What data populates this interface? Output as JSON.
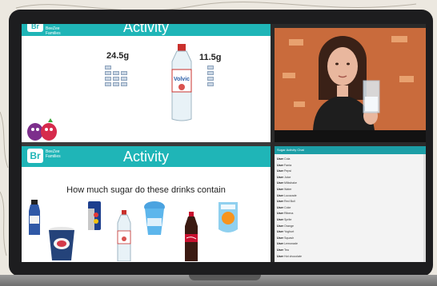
{
  "top_slide": {
    "logo_letter": "Br",
    "logo_text": "BeeZee Families",
    "title": "Activity",
    "left_amount": "24.5g",
    "right_amount": "11.5g"
  },
  "bottom_slide": {
    "logo_letter": "Br",
    "logo_text": "BeeZee Families",
    "title": "Activity",
    "question": "How much sugar do these drinks contain"
  },
  "chat": {
    "header": "Sugar Activity Chat",
    "lines": [
      {
        "user": "User",
        "text": "Cola"
      },
      {
        "user": "User",
        "text": "Fanta"
      },
      {
        "user": "User",
        "text": "Pepsi"
      },
      {
        "user": "User",
        "text": "Juice"
      },
      {
        "user": "User",
        "text": "Milkshake"
      },
      {
        "user": "User",
        "text": "Water"
      },
      {
        "user": "User",
        "text": "Lucozade"
      },
      {
        "user": "User",
        "text": "Red Bull"
      },
      {
        "user": "User",
        "text": "Coke"
      },
      {
        "user": "User",
        "text": "Ribena"
      },
      {
        "user": "User",
        "text": "Sprite"
      },
      {
        "user": "User",
        "text": "Orange"
      },
      {
        "user": "User",
        "text": "Yoghurt"
      },
      {
        "user": "User",
        "text": "Squash"
      },
      {
        "user": "User",
        "text": "Lemonade"
      },
      {
        "user": "User",
        "text": "Tea"
      },
      {
        "user": "User",
        "text": "Hot chocolate"
      }
    ]
  },
  "colors": {
    "teal": "#1fb5b7",
    "video_bg": "#c96b3c"
  }
}
